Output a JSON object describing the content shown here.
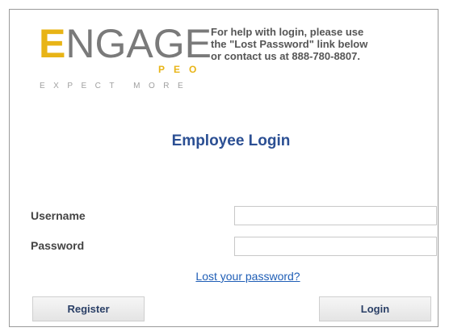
{
  "brand": {
    "logo_first_letter": "E",
    "logo_rest": "NGAGE",
    "logo_sub": "PEO",
    "logo_tagline": "EXPECT MORE",
    "accent_color": "#e8b416",
    "logo_gray": "#7a7a7a"
  },
  "help": {
    "line1": "For help with login, please use",
    "line2": "the \"Lost Password\" link below",
    "line3": "or contact us at 888-780-8807."
  },
  "page": {
    "title": "Employee Login",
    "title_color": "#2b4f93"
  },
  "form": {
    "username_label": "Username",
    "username_value": "",
    "password_label": "Password",
    "password_value": "",
    "forgot_link": "Lost your password?",
    "link_color": "#1f5eb6"
  },
  "buttons": {
    "register_label": "Register",
    "login_label": "Login"
  }
}
